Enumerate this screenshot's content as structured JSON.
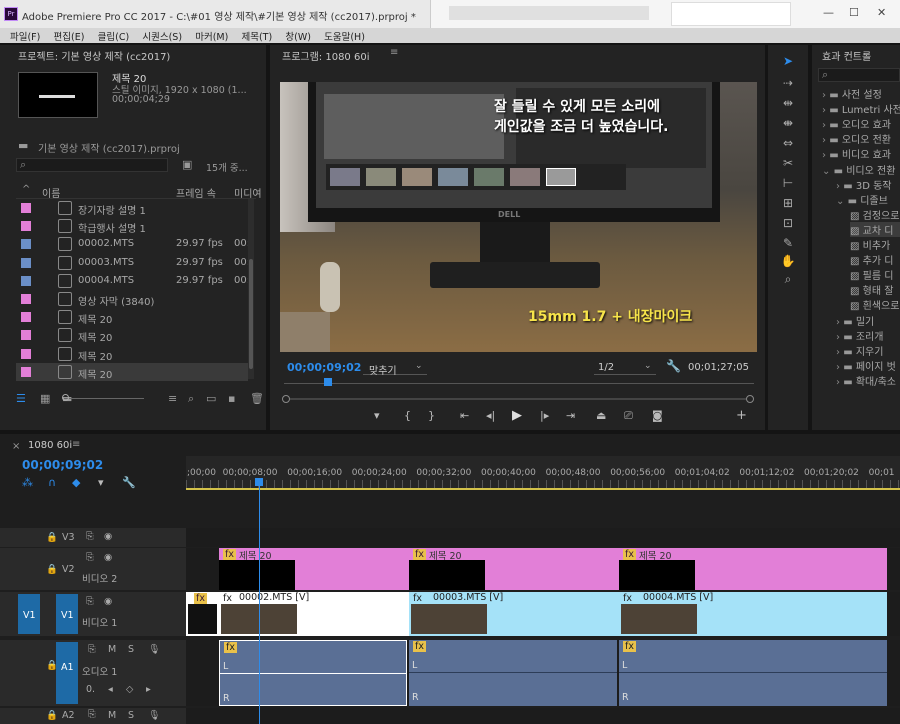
{
  "window": {
    "title": "Adobe Premiere Pro CC 2017 - C:\\#01 영상 제작\\#기본 영상 제작 (cc2017).prproj *",
    "app_icon": "Pr"
  },
  "menu": [
    "파일(F)",
    "편집(E)",
    "클립(C)",
    "시퀀스(S)",
    "마커(M)",
    "제목(T)",
    "창(W)",
    "도움말(H)"
  ],
  "project": {
    "title": "프로젝트: 기본 영상 제작 (cc2017)",
    "preview_name": "제목 20",
    "preview_info1": "스틸 이미지, 1920 x 1080 (1...",
    "preview_info2": "00;00;04;29",
    "project_file": "기본 영상 제작 (cc2017).prproj",
    "item_count": "15개 중...",
    "columns": {
      "name": "이름",
      "fps": "프레임 속",
      "media": "미디여"
    },
    "items": [
      {
        "name": "장기자랑 설명 1",
        "fps": "",
        "media": "",
        "color": "#e27fd7",
        "type": "title"
      },
      {
        "name": "학급행사 설명 1",
        "fps": "",
        "media": "",
        "color": "#e27fd7",
        "type": "title"
      },
      {
        "name": "00002.MTS",
        "fps": "29.97 fps",
        "media": "00:",
        "color": "#6b8fc7",
        "type": "clip"
      },
      {
        "name": "00003.MTS",
        "fps": "29.97 fps",
        "media": "00:",
        "color": "#6b8fc7",
        "type": "clip"
      },
      {
        "name": "00004.MTS",
        "fps": "29.97 fps",
        "media": "00:",
        "color": "#6b8fc7",
        "type": "clip"
      },
      {
        "name": "영상 자막 (3840)",
        "fps": "",
        "media": "",
        "color": "#e27fd7",
        "type": "title"
      },
      {
        "name": "제목 20",
        "fps": "",
        "media": "",
        "color": "#e27fd7",
        "type": "title"
      },
      {
        "name": "제목 20",
        "fps": "",
        "media": "",
        "color": "#e27fd7",
        "type": "title"
      },
      {
        "name": "제목 20",
        "fps": "",
        "media": "",
        "color": "#e27fd7",
        "type": "title"
      },
      {
        "name": "제목 20",
        "fps": "",
        "media": "",
        "color": "#e27fd7",
        "type": "title"
      }
    ]
  },
  "program": {
    "title": "프로그램: 1080 60i",
    "caption_top_line1": "잘 들릴 수 있게 모든 소리에",
    "caption_top_line2": "게인값을 조금 더 높였습니다.",
    "caption_bottom": "15mm 1.7 + 내장마이크",
    "monitor_brand": "DELL",
    "timecode": "00;00;09;02",
    "fit": "맞추기",
    "resolution": "1/2",
    "duration": "00;01;27;05"
  },
  "effects": {
    "title": "효과 컨트롤",
    "items": [
      {
        "label": "사전 설정",
        "level": 0,
        "kind": "folder"
      },
      {
        "label": "Lumetri 사전",
        "level": 0,
        "kind": "folder"
      },
      {
        "label": "오디오 효과",
        "level": 0,
        "kind": "folder"
      },
      {
        "label": "오디오 전환",
        "level": 0,
        "kind": "folder"
      },
      {
        "label": "비디오 효과",
        "level": 0,
        "kind": "folder"
      },
      {
        "label": "비디오 전환",
        "level": 0,
        "kind": "folder-open"
      },
      {
        "label": "3D 동작",
        "level": 1,
        "kind": "folder"
      },
      {
        "label": "디졸브",
        "level": 1,
        "kind": "folder-open"
      },
      {
        "label": "검정으로",
        "level": 2,
        "kind": "effect"
      },
      {
        "label": "교차 디",
        "level": 2,
        "kind": "effect-selected"
      },
      {
        "label": "비추가",
        "level": 2,
        "kind": "effect"
      },
      {
        "label": "추가 디",
        "level": 2,
        "kind": "effect"
      },
      {
        "label": "필름 디",
        "level": 2,
        "kind": "effect"
      },
      {
        "label": "형태 잘",
        "level": 2,
        "kind": "effect"
      },
      {
        "label": "흰색으로",
        "level": 2,
        "kind": "effect"
      },
      {
        "label": "밀기",
        "level": 1,
        "kind": "folder"
      },
      {
        "label": "조리개",
        "level": 1,
        "kind": "folder"
      },
      {
        "label": "지우기",
        "level": 1,
        "kind": "folder"
      },
      {
        "label": "페이지 벗",
        "level": 1,
        "kind": "folder"
      },
      {
        "label": "확대/축소",
        "level": 1,
        "kind": "folder"
      }
    ]
  },
  "timeline": {
    "sequence_tab": "1080 60i",
    "timecode": "00;00;09;02",
    "ruler": [
      ";00;00",
      "00;00;08;00",
      "00;00;16;00",
      "00;00;24;00",
      "00;00;32;00",
      "00;00;40;00",
      "00;00;48;00",
      "00;00;56;00",
      "00;01;04;02",
      "00;01;12;02",
      "00;01;20;02",
      "00;01"
    ],
    "tracks": {
      "v3": "V3",
      "v2": "V2",
      "v2_name": "비디오 2",
      "v1_src": "V1",
      "v1": "V1",
      "v1_name": "비디오 1",
      "a1": "A1",
      "a1_name": "오디오 1",
      "a2": "A2"
    },
    "m_label": "M",
    "s_label": "S",
    "fx_badge": "fx",
    "title_clips": [
      "제목 20",
      "제목 20",
      "제목 20"
    ],
    "video_clips": [
      "00002.MTS [V]",
      "00003.MTS [V]",
      "00004.MTS [V]"
    ],
    "audio_channel_l": "L",
    "audio_channel_r": "R",
    "audio_value": "0."
  },
  "colors": {
    "accent_blue": "#2d8ceb",
    "title_pink": "#e27fd7",
    "clip_cyan": "#a5e2f8",
    "audio_blue": "#5a6f95",
    "track_target_blue": "#1e6aa6"
  }
}
